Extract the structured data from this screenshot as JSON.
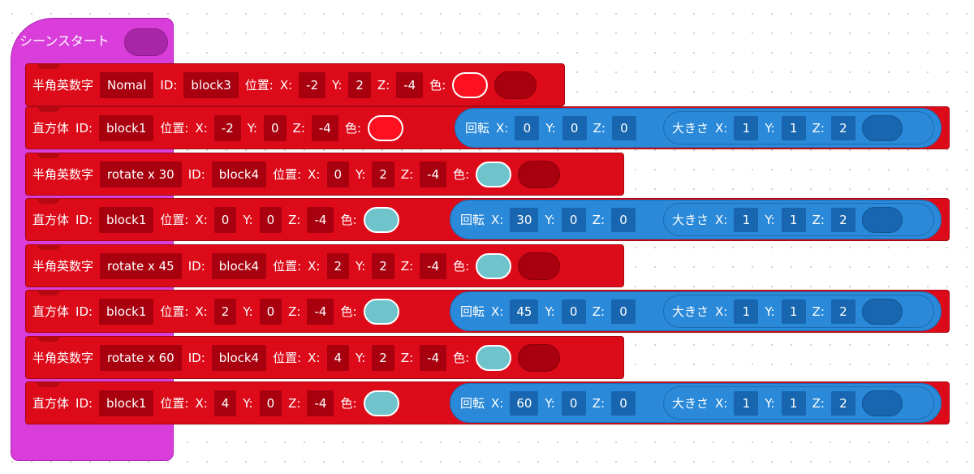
{
  "hat": {
    "label": "シーンスタート"
  },
  "labels": {
    "text_block": "半角英数字",
    "cuboid": "直方体",
    "id": "ID:",
    "position": "位置:",
    "x": "X:",
    "y": "Y:",
    "z": "Z:",
    "color": "色:",
    "rotation": "回転",
    "size": "大きさ"
  },
  "colors": {
    "hat": "#d93edb",
    "block": "#dd0b19",
    "field": "#a8000f",
    "blue": "#2a89d9",
    "red_swatch": "#ff1020",
    "teal_swatch": "#6fc4cc"
  },
  "rows": [
    {
      "type": "text",
      "text": "Nomal",
      "id": "block3",
      "x": "-2",
      "y": "2",
      "z": "-4",
      "color": "#ff1020"
    },
    {
      "type": "cuboid",
      "id": "block1",
      "x": "-2",
      "y": "0",
      "z": "-4",
      "color": "#ff1020",
      "rot": {
        "x": "0",
        "y": "0",
        "z": "0"
      },
      "size": {
        "x": "1",
        "y": "1",
        "z": "2"
      }
    },
    {
      "type": "text",
      "text": "rotate x 30",
      "id": "block4",
      "x": "0",
      "y": "2",
      "z": "-4",
      "color": "#6fc4cc"
    },
    {
      "type": "cuboid",
      "id": "block1",
      "x": "0",
      "y": "0",
      "z": "-4",
      "color": "#6fc4cc",
      "rot": {
        "x": "30",
        "y": "0",
        "z": "0"
      },
      "size": {
        "x": "1",
        "y": "1",
        "z": "2"
      }
    },
    {
      "type": "text",
      "text": "rotate x 45",
      "id": "block4",
      "x": "2",
      "y": "2",
      "z": "-4",
      "color": "#6fc4cc"
    },
    {
      "type": "cuboid",
      "id": "block1",
      "x": "2",
      "y": "0",
      "z": "-4",
      "color": "#6fc4cc",
      "rot": {
        "x": "45",
        "y": "0",
        "z": "0"
      },
      "size": {
        "x": "1",
        "y": "1",
        "z": "2"
      }
    },
    {
      "type": "text",
      "text": "rotate x 60",
      "id": "block4",
      "x": "4",
      "y": "2",
      "z": "-4",
      "color": "#6fc4cc"
    },
    {
      "type": "cuboid",
      "id": "block1",
      "x": "4",
      "y": "0",
      "z": "-4",
      "color": "#6fc4cc",
      "rot": {
        "x": "60",
        "y": "0",
        "z": "0"
      },
      "size": {
        "x": "1",
        "y": "1",
        "z": "2"
      }
    }
  ]
}
